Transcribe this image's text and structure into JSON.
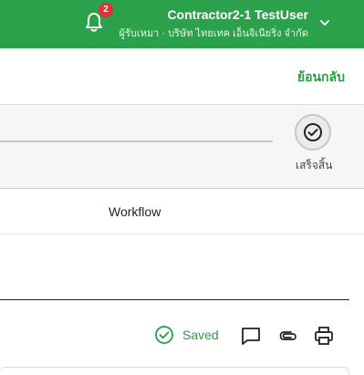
{
  "header": {
    "notification_count": "2",
    "user_name": "Contractor2-1 TestUser",
    "user_subtitle": "ผู้รับเหมา · บริษัท ไทยเทค เอ็นจิเนียริ่ง จำกัด",
    "bell_icon": "bell-icon",
    "dropdown_icon": "chevron-down-icon",
    "background_color": "#2aa14a"
  },
  "backbar": {
    "back_label": "ย้อนกลับ",
    "accent_color": "#2a9b45"
  },
  "progress": {
    "step_label": "เสร็จสิ้น",
    "step_icon": "check-circle-icon"
  },
  "tabs": {
    "workflow_label": "Workflow"
  },
  "toolbar": {
    "saved_label": "Saved",
    "saved_icon": "check-circle-icon",
    "comment_icon": "comment-icon",
    "attach_icon": "paperclip-icon",
    "print_icon": "printer-icon"
  }
}
